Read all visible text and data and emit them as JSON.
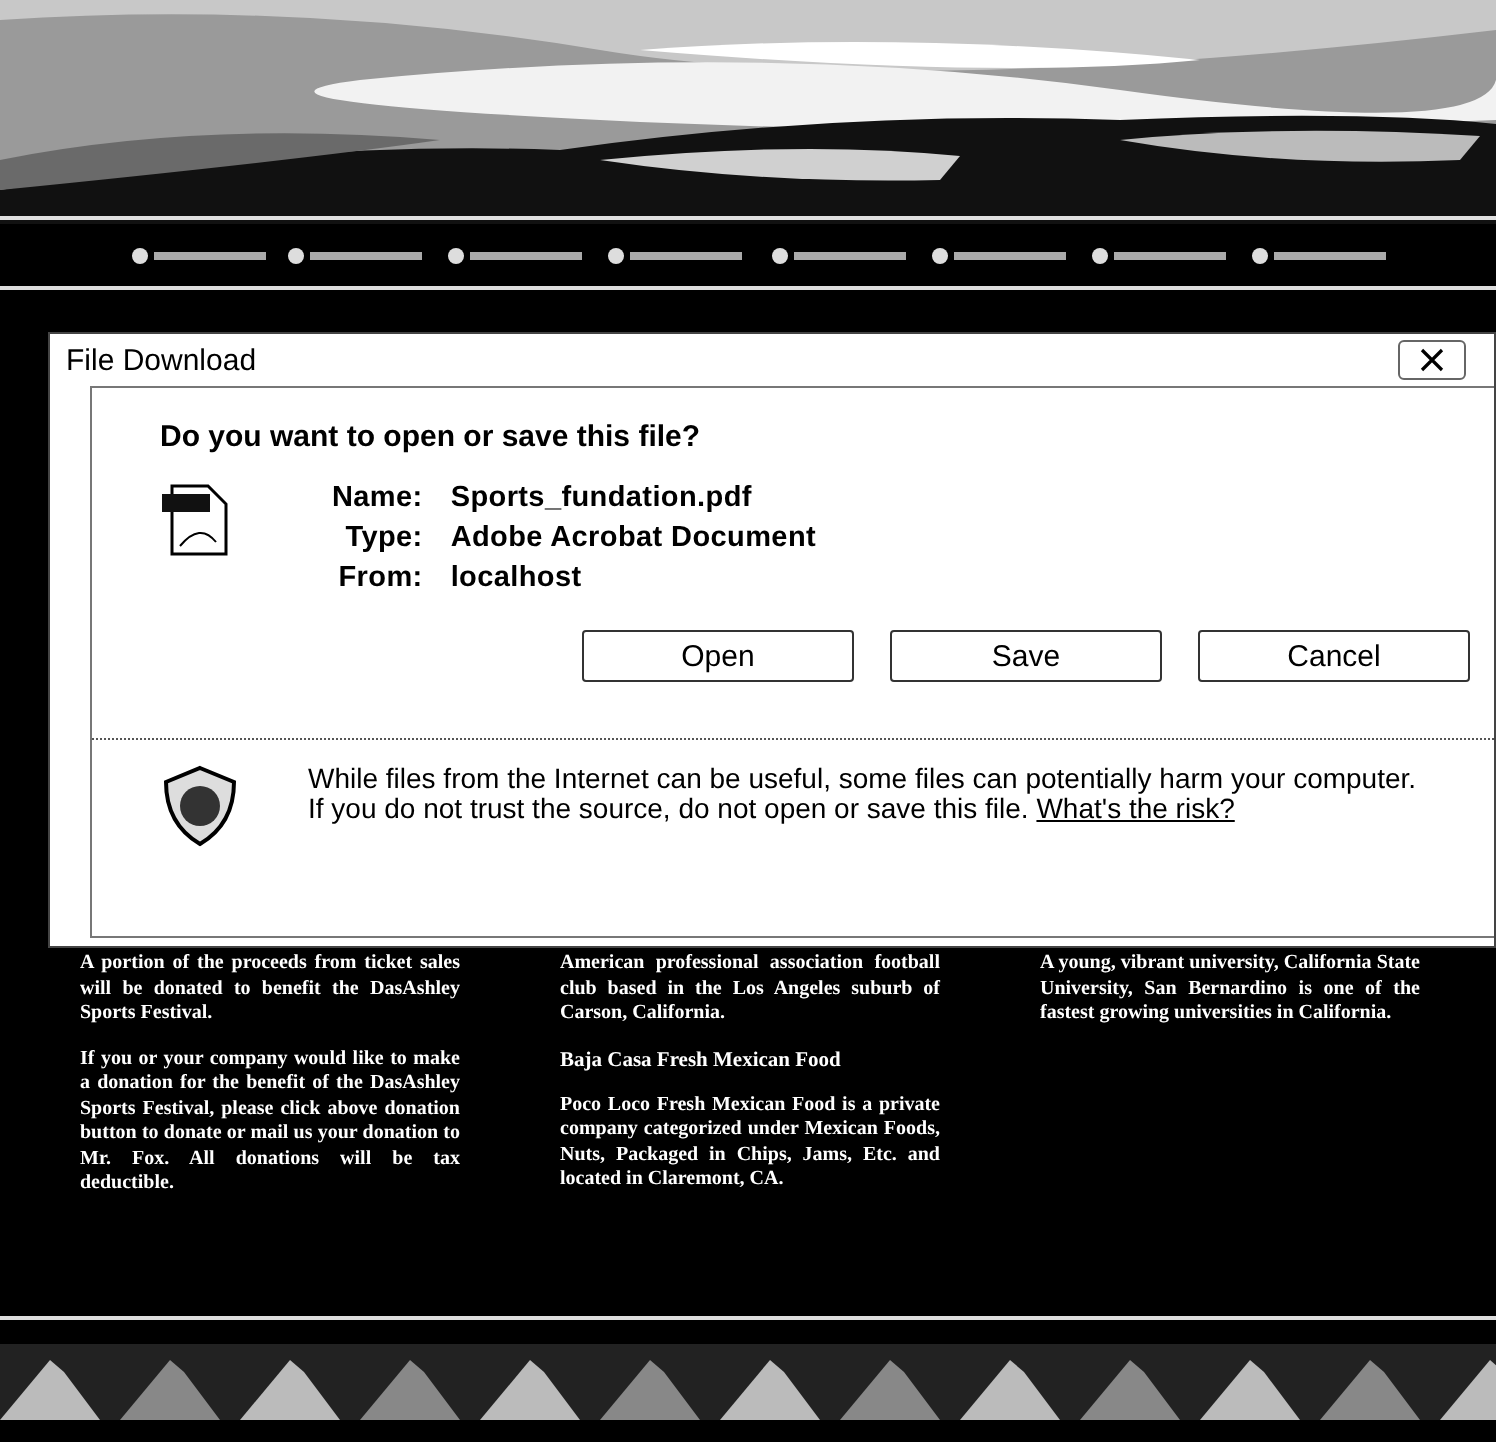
{
  "dialog": {
    "title": "File Download",
    "question": "Do you want to open or save this file?",
    "fields": [
      {
        "label": "Name:",
        "value": "Sports_fundation.pdf"
      },
      {
        "label": "Type:",
        "value": "Adobe Acrobat Document"
      },
      {
        "label": "From:",
        "value": "localhost"
      }
    ],
    "buttons": [
      "Open",
      "Save",
      "Cancel"
    ],
    "warning": {
      "text": "While files from the Internet can be useful, some files can potentially harm your computer. If you do not trust the source, do not open or save this file.",
      "link": "What's the risk?"
    }
  },
  "columns": [
    [
      {
        "kind": "text",
        "text": "A portion of the proceeds from ticket sales will be donated to benefit the DasAshley Sports Festival."
      },
      {
        "kind": "text",
        "text": "If you or your company would like to make a donation for the benefit of the DasAshley Sports Festival, please click above donation button to donate or mail us your donation to Mr. Fox. All donations will be tax deductible."
      }
    ],
    [
      {
        "kind": "text",
        "text": "American professional association football club based in the Los Angeles suburb of Carson, California."
      },
      {
        "kind": "heading",
        "text": "Baja Casa Fresh Mexican Food"
      },
      {
        "kind": "text",
        "text": "Poco Loco Fresh Mexican Food is a private company categorized under Mexican Foods, Nuts, Packaged in Chips, Jams, Etc. and located in Claremont, CA."
      }
    ],
    [
      {
        "kind": "text",
        "text": "A young, vibrant university, California State University, San Bernardino is one of the fastest growing universities in California."
      }
    ]
  ]
}
